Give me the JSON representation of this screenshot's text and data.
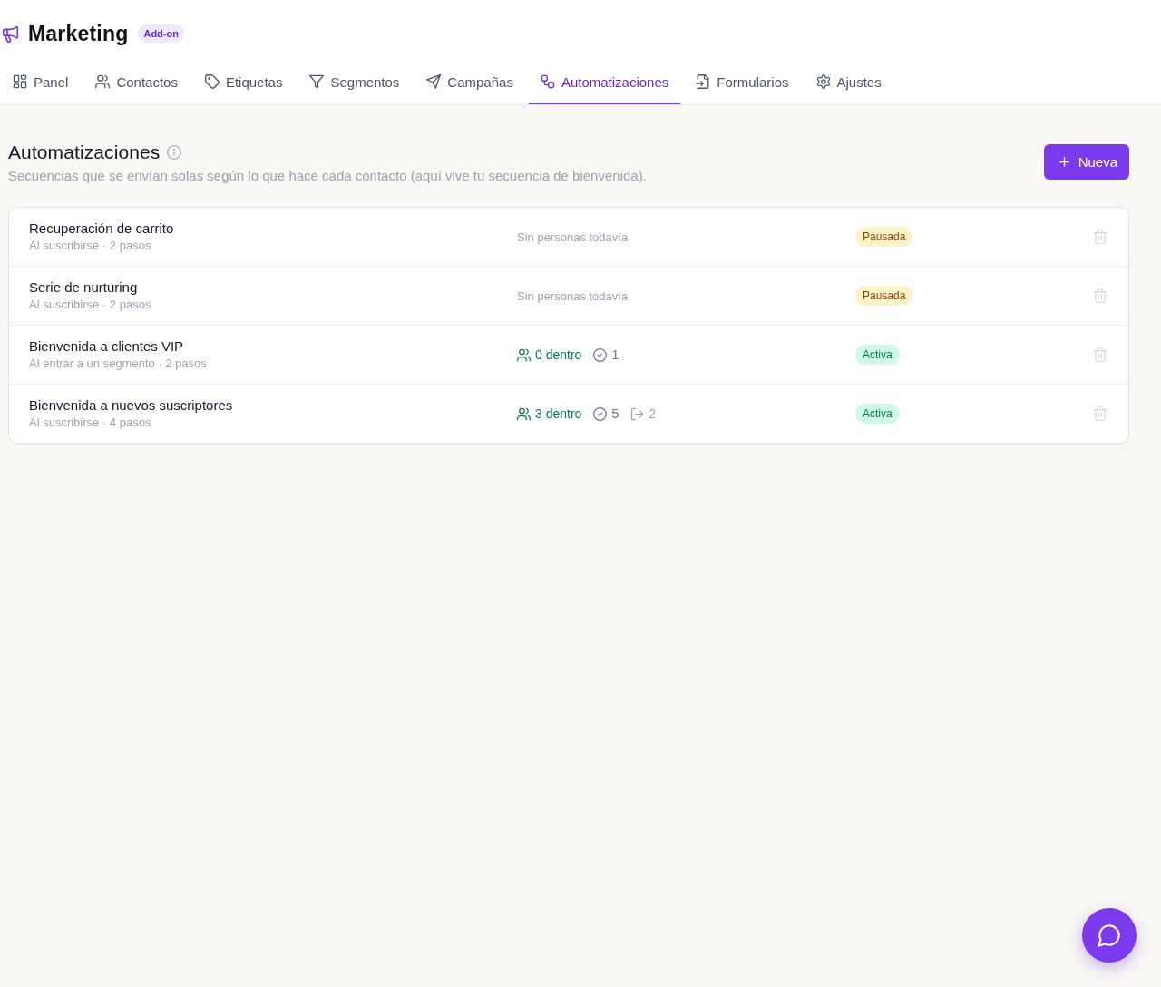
{
  "header": {
    "title": "Marketing",
    "badge": "Add-on"
  },
  "tabs": [
    {
      "label": "Panel",
      "selected": false
    },
    {
      "label": "Contactos",
      "selected": false
    },
    {
      "label": "Etiquetas",
      "selected": false
    },
    {
      "label": "Segmentos",
      "selected": false
    },
    {
      "label": "Campañas",
      "selected": false
    },
    {
      "label": "Automatizaciones",
      "selected": true
    },
    {
      "label": "Formularios",
      "selected": false
    },
    {
      "label": "Ajustes",
      "selected": false
    }
  ],
  "page": {
    "title": "Automatizaciones",
    "subtitle": "Secuencias que se envían solas según lo que hace cada contacto (aquí vive tu secuencia de bienvenida).",
    "new_button": "Nueva"
  },
  "automations": [
    {
      "name": "Recuperación de carrito",
      "trigger": "Al suscribirse · 2 pasos",
      "activity": {
        "kind": "empty",
        "text": "Sin personas todavía"
      },
      "status": {
        "label": "Pausada",
        "kind": "paused"
      }
    },
    {
      "name": "Serie de nurturing",
      "trigger": "Al suscribirse · 2 pasos",
      "activity": {
        "kind": "empty",
        "text": "Sin personas todavía"
      },
      "status": {
        "label": "Pausada",
        "kind": "paused"
      }
    },
    {
      "name": "Bienvenida a clientes VIP",
      "trigger": "Al entrar a un segmento · 2 pasos",
      "activity": {
        "kind": "counts",
        "inside": "0 dentro",
        "completed": "1"
      },
      "status": {
        "label": "Activa",
        "kind": "active"
      }
    },
    {
      "name": "Bienvenida a nuevos suscriptores",
      "trigger": "Al suscribirse · 4 pasos",
      "activity": {
        "kind": "counts",
        "inside": "3 dentro",
        "completed": "5",
        "exited": "2"
      },
      "status": {
        "label": "Activa",
        "kind": "active"
      }
    }
  ]
}
